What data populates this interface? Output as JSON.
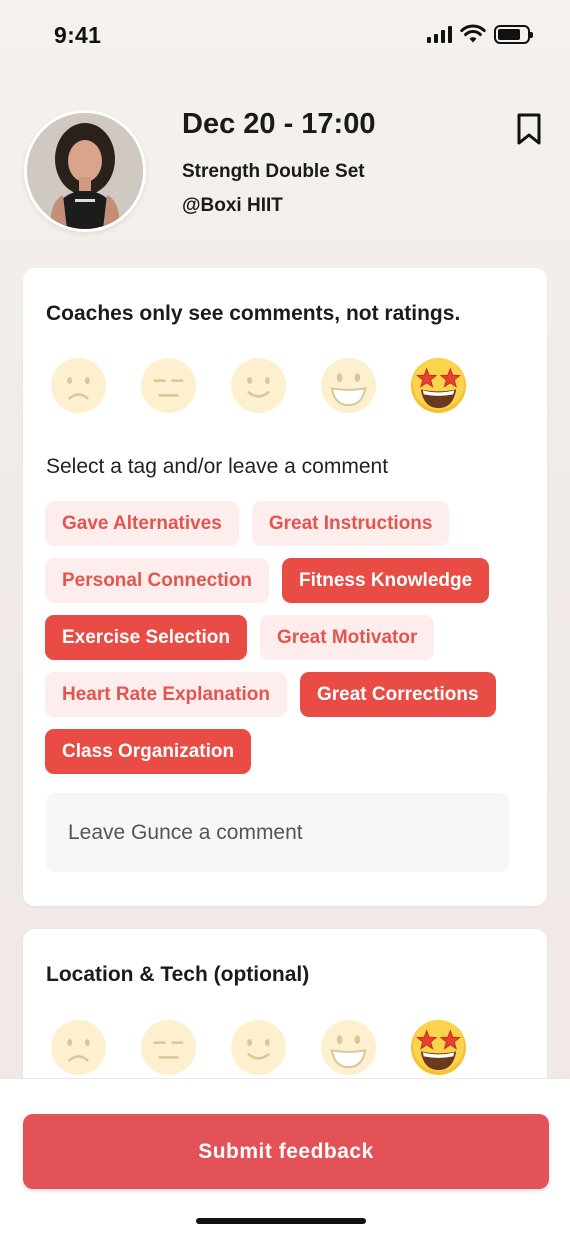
{
  "status_bar": {
    "time": "9:41"
  },
  "header": {
    "date_time": "Dec 20 - 17:00",
    "class_name": "Strength Double Set",
    "studio": "@Boxi HIIT",
    "bookmark_icon": "bookmark-icon"
  },
  "coach_card": {
    "title": "Coaches only see comments, not ratings.",
    "ratings": [
      {
        "icon": "frowning-face-icon",
        "selected": false
      },
      {
        "icon": "neutral-face-icon",
        "selected": false
      },
      {
        "icon": "slightly-smiling-face-icon",
        "selected": false
      },
      {
        "icon": "grinning-face-icon",
        "selected": false
      },
      {
        "icon": "star-struck-face-icon",
        "selected": true
      }
    ],
    "tag_prompt": "Select a tag and/or leave a comment",
    "tags": [
      {
        "label": "Gave Alternatives",
        "selected": false
      },
      {
        "label": "Great Instructions",
        "selected": false
      },
      {
        "label": "Personal Connection",
        "selected": false
      },
      {
        "label": "Fitness Knowledge",
        "selected": true
      },
      {
        "label": "Exercise Selection",
        "selected": true
      },
      {
        "label": "Great Motivator",
        "selected": false
      },
      {
        "label": "Heart Rate Explanation",
        "selected": false
      },
      {
        "label": "Great Corrections",
        "selected": true
      },
      {
        "label": "Class Organization",
        "selected": true
      }
    ],
    "comment_placeholder": "Leave Gunce a comment"
  },
  "location_card": {
    "title": "Location & Tech (optional)",
    "ratings": [
      {
        "icon": "frowning-face-icon",
        "selected": false
      },
      {
        "icon": "neutral-face-icon",
        "selected": false
      },
      {
        "icon": "slightly-smiling-face-icon",
        "selected": false
      },
      {
        "icon": "grinning-face-icon",
        "selected": false
      },
      {
        "icon": "star-struck-face-icon",
        "selected": true
      }
    ]
  },
  "footer": {
    "submit_label": "Submit feedback"
  },
  "colors": {
    "accent": "#e94c45",
    "tag_unselected_bg": "#fdeeed",
    "tag_unselected_text": "#e4554f",
    "submit_bg": "#e35257"
  }
}
